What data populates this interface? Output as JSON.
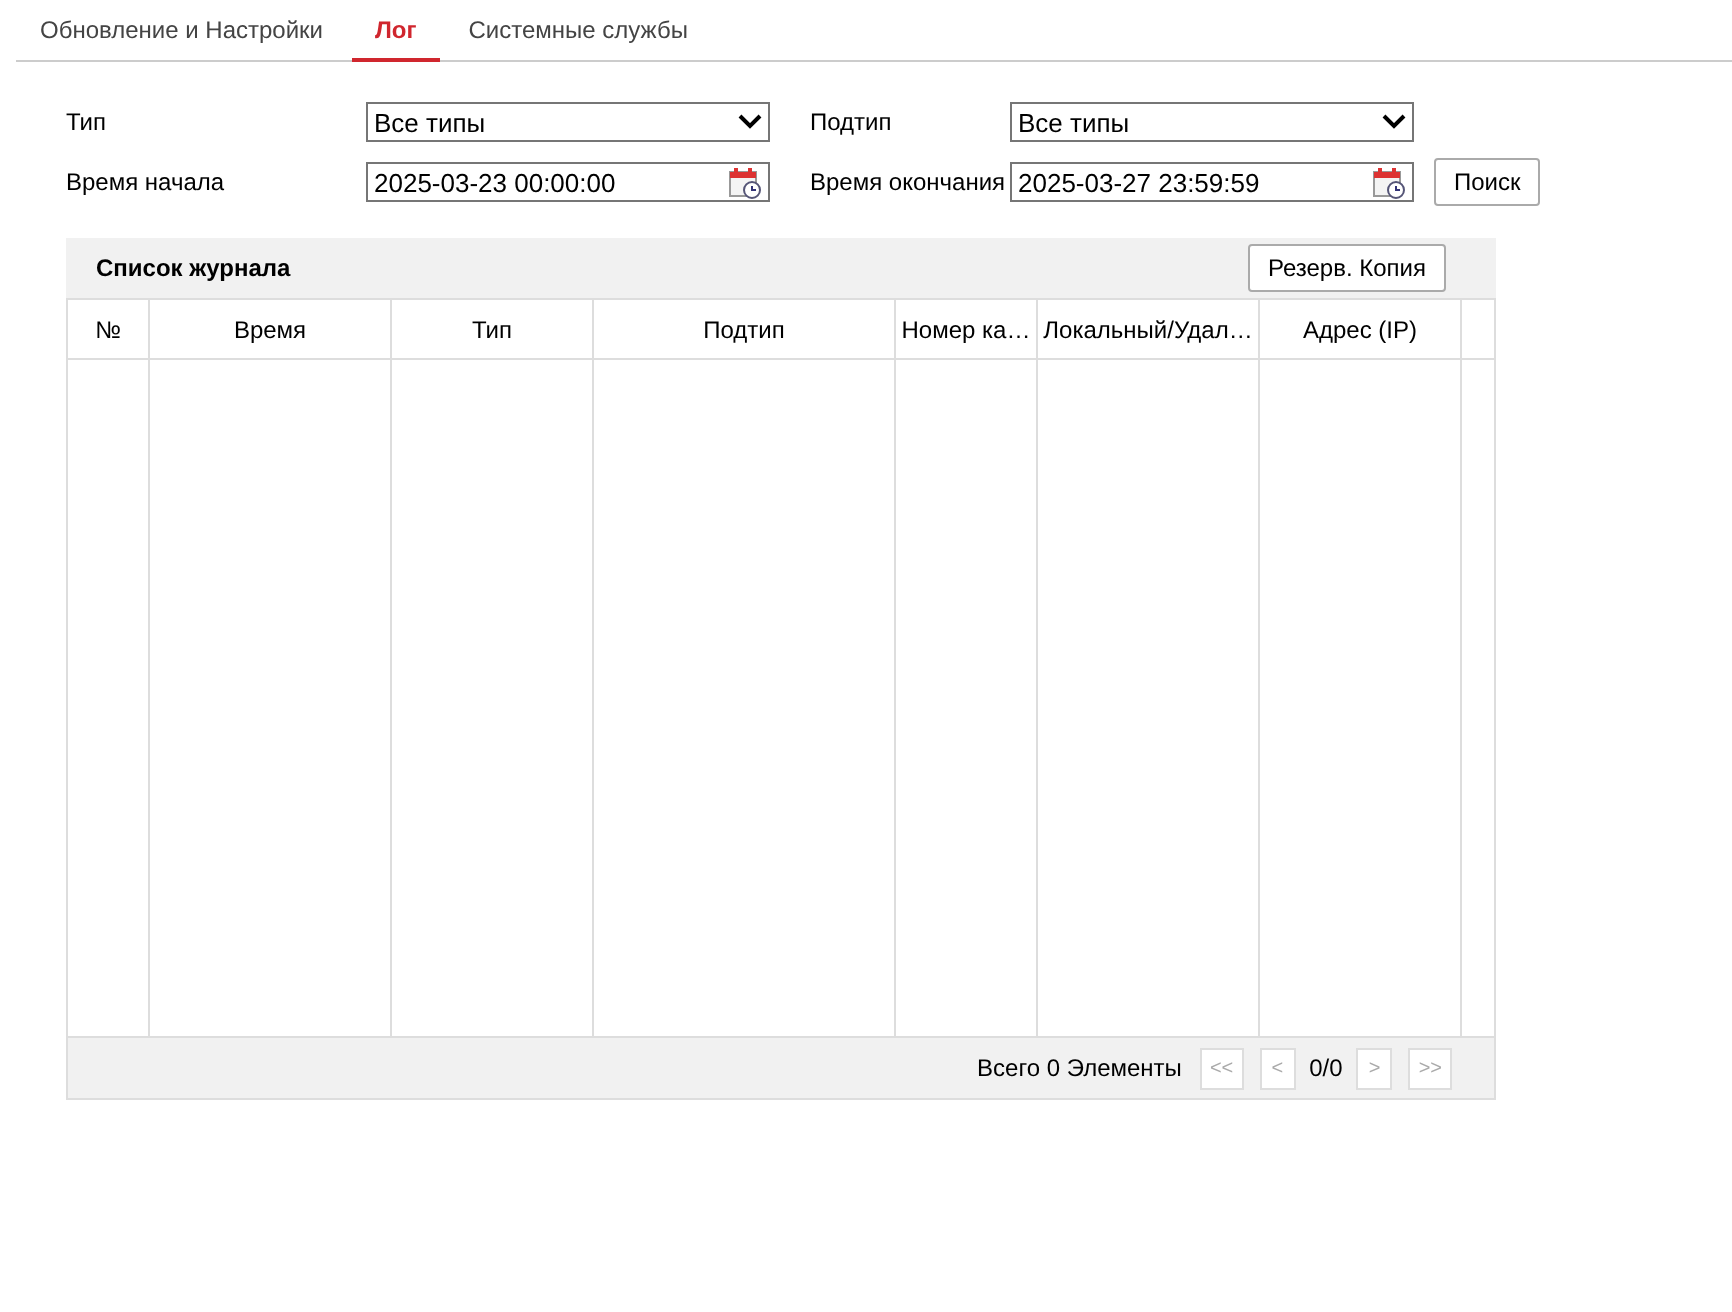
{
  "tabs": [
    {
      "label": "Обновление и Настройки",
      "selected": false
    },
    {
      "label": "Лог",
      "selected": true
    },
    {
      "label": "Системные службы",
      "selected": false
    }
  ],
  "filters": {
    "type_label": "Тип",
    "type_value": "Все типы",
    "subtype_label": "Подтип",
    "subtype_value": "Все типы",
    "start_label": "Время начала",
    "start_value": "2025-03-23 00:00:00",
    "end_label": "Время окончания",
    "end_value": "2025-03-27 23:59:59",
    "search_button": "Поиск"
  },
  "log_list": {
    "title": "Список журнала",
    "backup_button": "Резерв. Копия",
    "columns": [
      "№",
      "Время",
      "Тип",
      "Подтип",
      "Номер ка…",
      "Локальный/Удал…",
      "Адрес (IP)"
    ],
    "total": "Всего 0 Элементы",
    "page": "0/0",
    "pager": [
      {
        "label": "<<",
        "disabled": true
      },
      {
        "label": "<",
        "disabled": true
      },
      {
        "label": ">",
        "disabled": true
      },
      {
        "label": ">>",
        "disabled": true
      }
    ]
  }
}
